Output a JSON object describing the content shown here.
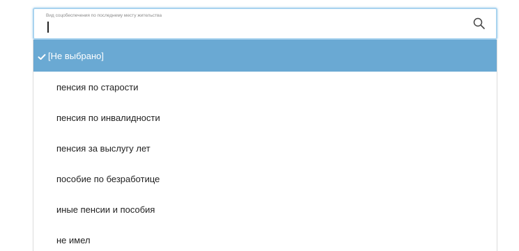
{
  "field": {
    "label": "Вид соцобеспечения по последнему месту жительства",
    "value": "",
    "search_icon": "search-icon"
  },
  "dropdown": {
    "selected_index": 0,
    "options": [
      {
        "label": "[Не выбрано]",
        "selected": true,
        "icon": "check-icon"
      },
      {
        "label": "пенсия по старости",
        "selected": false
      },
      {
        "label": "пенсия по инвалидности",
        "selected": false
      },
      {
        "label": "пенсия за выслугу лет",
        "selected": false
      },
      {
        "label": "пособие по безработице",
        "selected": false
      },
      {
        "label": "иные пенсии и пособия",
        "selected": false
      },
      {
        "label": "не имел",
        "selected": false
      }
    ]
  },
  "colors": {
    "selected_bg": "#6aa9d3",
    "focus_border": "#a8d3ef"
  }
}
